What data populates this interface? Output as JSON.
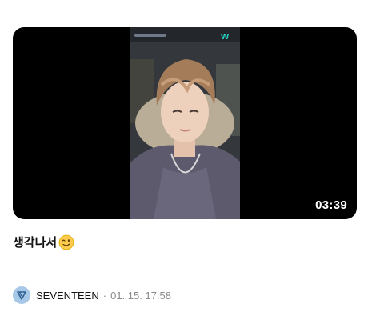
{
  "post": {
    "video": {
      "duration": "03:39",
      "watermark_icon": "weverse-w-icon"
    },
    "caption": {
      "text": "생각나서",
      "emoji": "winking-face-emoji"
    },
    "author": {
      "avatar_icon": "seventeen-logo-icon",
      "name": "SEVENTEEN",
      "separator": "·",
      "date": "01. 15. 17:58"
    }
  },
  "colors": {
    "video_background": "#000000",
    "avatar_background": "#a7c8e6",
    "meta_gray": "#8a8a8a",
    "watermark_teal": "#25d6c6"
  }
}
